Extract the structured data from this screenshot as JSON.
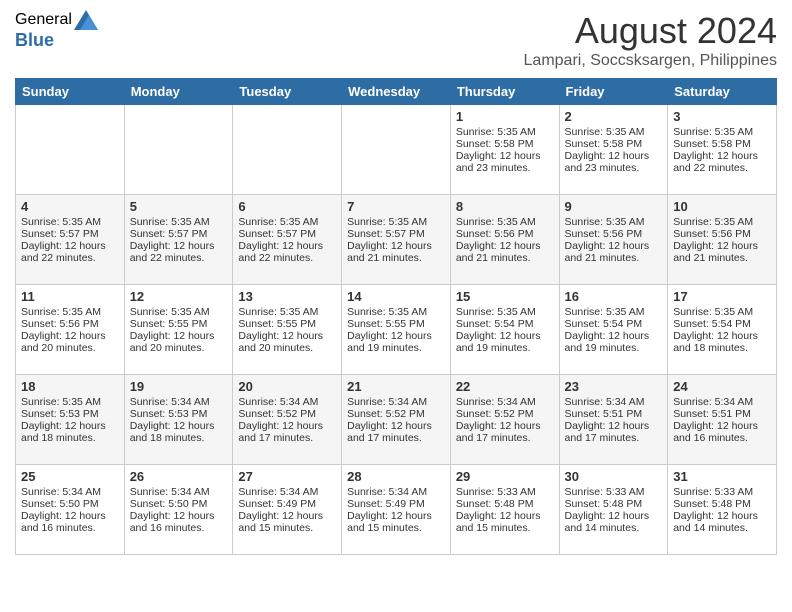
{
  "header": {
    "logo_general": "General",
    "logo_blue": "Blue",
    "month_title": "August 2024",
    "location": "Lampari, Soccsksargen, Philippines"
  },
  "days_of_week": [
    "Sunday",
    "Monday",
    "Tuesday",
    "Wednesday",
    "Thursday",
    "Friday",
    "Saturday"
  ],
  "weeks": [
    [
      {
        "day": "",
        "info": ""
      },
      {
        "day": "",
        "info": ""
      },
      {
        "day": "",
        "info": ""
      },
      {
        "day": "",
        "info": ""
      },
      {
        "day": "1",
        "info": "Sunrise: 5:35 AM\nSunset: 5:58 PM\nDaylight: 12 hours\nand 23 minutes."
      },
      {
        "day": "2",
        "info": "Sunrise: 5:35 AM\nSunset: 5:58 PM\nDaylight: 12 hours\nand 23 minutes."
      },
      {
        "day": "3",
        "info": "Sunrise: 5:35 AM\nSunset: 5:58 PM\nDaylight: 12 hours\nand 22 minutes."
      }
    ],
    [
      {
        "day": "4",
        "info": "Sunrise: 5:35 AM\nSunset: 5:57 PM\nDaylight: 12 hours\nand 22 minutes."
      },
      {
        "day": "5",
        "info": "Sunrise: 5:35 AM\nSunset: 5:57 PM\nDaylight: 12 hours\nand 22 minutes."
      },
      {
        "day": "6",
        "info": "Sunrise: 5:35 AM\nSunset: 5:57 PM\nDaylight: 12 hours\nand 22 minutes."
      },
      {
        "day": "7",
        "info": "Sunrise: 5:35 AM\nSunset: 5:57 PM\nDaylight: 12 hours\nand 21 minutes."
      },
      {
        "day": "8",
        "info": "Sunrise: 5:35 AM\nSunset: 5:56 PM\nDaylight: 12 hours\nand 21 minutes."
      },
      {
        "day": "9",
        "info": "Sunrise: 5:35 AM\nSunset: 5:56 PM\nDaylight: 12 hours\nand 21 minutes."
      },
      {
        "day": "10",
        "info": "Sunrise: 5:35 AM\nSunset: 5:56 PM\nDaylight: 12 hours\nand 21 minutes."
      }
    ],
    [
      {
        "day": "11",
        "info": "Sunrise: 5:35 AM\nSunset: 5:56 PM\nDaylight: 12 hours\nand 20 minutes."
      },
      {
        "day": "12",
        "info": "Sunrise: 5:35 AM\nSunset: 5:55 PM\nDaylight: 12 hours\nand 20 minutes."
      },
      {
        "day": "13",
        "info": "Sunrise: 5:35 AM\nSunset: 5:55 PM\nDaylight: 12 hours\nand 20 minutes."
      },
      {
        "day": "14",
        "info": "Sunrise: 5:35 AM\nSunset: 5:55 PM\nDaylight: 12 hours\nand 19 minutes."
      },
      {
        "day": "15",
        "info": "Sunrise: 5:35 AM\nSunset: 5:54 PM\nDaylight: 12 hours\nand 19 minutes."
      },
      {
        "day": "16",
        "info": "Sunrise: 5:35 AM\nSunset: 5:54 PM\nDaylight: 12 hours\nand 19 minutes."
      },
      {
        "day": "17",
        "info": "Sunrise: 5:35 AM\nSunset: 5:54 PM\nDaylight: 12 hours\nand 18 minutes."
      }
    ],
    [
      {
        "day": "18",
        "info": "Sunrise: 5:35 AM\nSunset: 5:53 PM\nDaylight: 12 hours\nand 18 minutes."
      },
      {
        "day": "19",
        "info": "Sunrise: 5:34 AM\nSunset: 5:53 PM\nDaylight: 12 hours\nand 18 minutes."
      },
      {
        "day": "20",
        "info": "Sunrise: 5:34 AM\nSunset: 5:52 PM\nDaylight: 12 hours\nand 17 minutes."
      },
      {
        "day": "21",
        "info": "Sunrise: 5:34 AM\nSunset: 5:52 PM\nDaylight: 12 hours\nand 17 minutes."
      },
      {
        "day": "22",
        "info": "Sunrise: 5:34 AM\nSunset: 5:52 PM\nDaylight: 12 hours\nand 17 minutes."
      },
      {
        "day": "23",
        "info": "Sunrise: 5:34 AM\nSunset: 5:51 PM\nDaylight: 12 hours\nand 17 minutes."
      },
      {
        "day": "24",
        "info": "Sunrise: 5:34 AM\nSunset: 5:51 PM\nDaylight: 12 hours\nand 16 minutes."
      }
    ],
    [
      {
        "day": "25",
        "info": "Sunrise: 5:34 AM\nSunset: 5:50 PM\nDaylight: 12 hours\nand 16 minutes."
      },
      {
        "day": "26",
        "info": "Sunrise: 5:34 AM\nSunset: 5:50 PM\nDaylight: 12 hours\nand 16 minutes."
      },
      {
        "day": "27",
        "info": "Sunrise: 5:34 AM\nSunset: 5:49 PM\nDaylight: 12 hours\nand 15 minutes."
      },
      {
        "day": "28",
        "info": "Sunrise: 5:34 AM\nSunset: 5:49 PM\nDaylight: 12 hours\nand 15 minutes."
      },
      {
        "day": "29",
        "info": "Sunrise: 5:33 AM\nSunset: 5:48 PM\nDaylight: 12 hours\nand 15 minutes."
      },
      {
        "day": "30",
        "info": "Sunrise: 5:33 AM\nSunset: 5:48 PM\nDaylight: 12 hours\nand 14 minutes."
      },
      {
        "day": "31",
        "info": "Sunrise: 5:33 AM\nSunset: 5:48 PM\nDaylight: 12 hours\nand 14 minutes."
      }
    ]
  ]
}
